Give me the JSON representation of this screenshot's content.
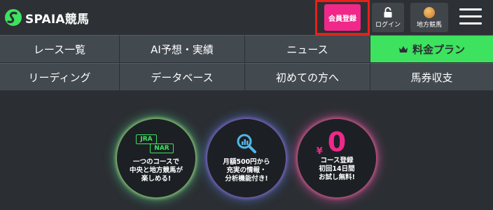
{
  "header": {
    "logo_text": "SPAIA競馬",
    "member_button": "会員登録",
    "login_button": "ログイン",
    "chiho_button": "地方競馬",
    "menu_icon": "hamburger-menu-icon"
  },
  "nav": {
    "row1": [
      "レース一覧",
      "AI予想・実績",
      "ニュース",
      "料金プラン"
    ],
    "row2": [
      "リーディング",
      "データベース",
      "初めての方へ",
      "馬券収支"
    ]
  },
  "promos": [
    {
      "badges": [
        "JRA",
        "NAR"
      ],
      "lines": [
        "一つのコースで",
        "中央と地方競馬が",
        "楽しめる!"
      ]
    },
    {
      "icon": "magnifier-chart-icon",
      "lines": [
        "月額500円から",
        "充実の情報・",
        "分析機能付き!"
      ]
    },
    {
      "big_number": "0",
      "currency": "¥",
      "lines": [
        "コース登録",
        "初回14日間",
        "お試し無料!"
      ]
    }
  ],
  "colors": {
    "accent_green": "#3de25e",
    "accent_pink": "#f0288a",
    "highlight_border": "#e8201a",
    "background": "#2b2f33"
  }
}
